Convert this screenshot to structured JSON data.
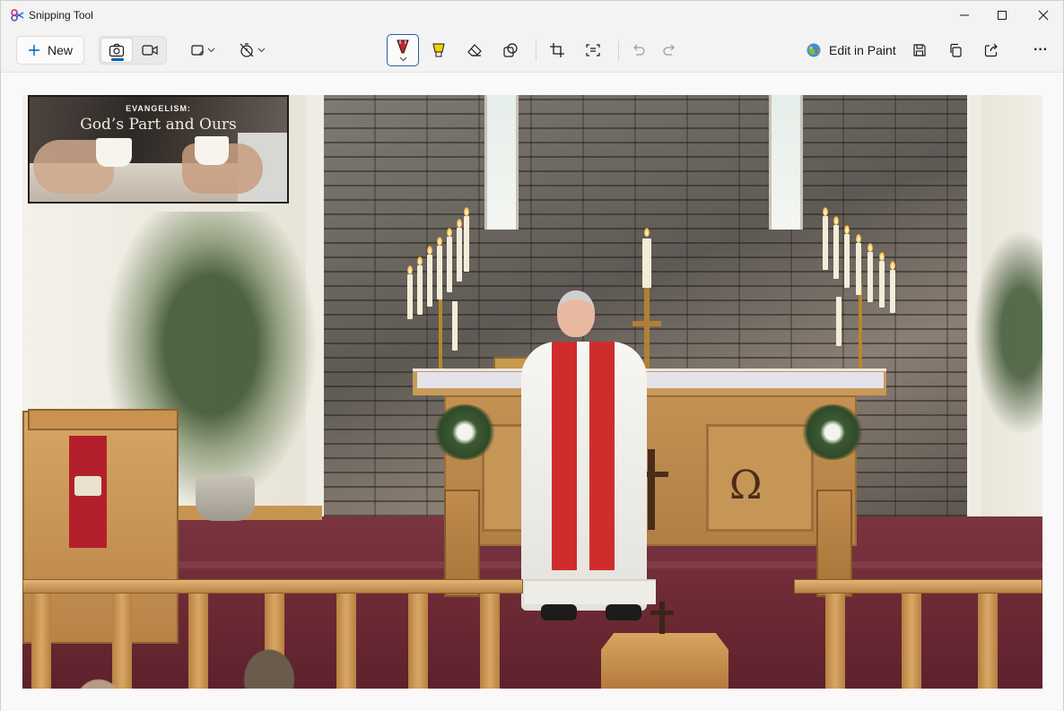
{
  "window": {
    "title": "Snipping Tool",
    "minimize_glyph": "─",
    "maximize_glyph": "☐",
    "close_glyph": "✕"
  },
  "toolbar": {
    "new_label": "New",
    "edit_in_paint_label": "Edit in Paint",
    "selected_mode": "photo",
    "active_tool": "ballpoint-pen",
    "pen_color": "#c1272d",
    "highlighter_color": "#f4d000",
    "accent_color": "#005fb8",
    "icons": [
      "plus-icon",
      "camera-icon",
      "video-icon",
      "snip-shape-icon",
      "timer-off-icon",
      "ballpoint-pen-icon",
      "highlighter-icon",
      "eraser-icon",
      "shapes-icon",
      "crop-icon",
      "text-actions-icon",
      "undo-icon",
      "redo-icon",
      "paint-icon",
      "save-icon",
      "copy-icon",
      "share-icon",
      "more-icon"
    ],
    "more_glyph": "···"
  },
  "screenshot": {
    "overlay_kicker": "EVANGELISM:",
    "overlay_title": "God’s Part and Ours"
  }
}
